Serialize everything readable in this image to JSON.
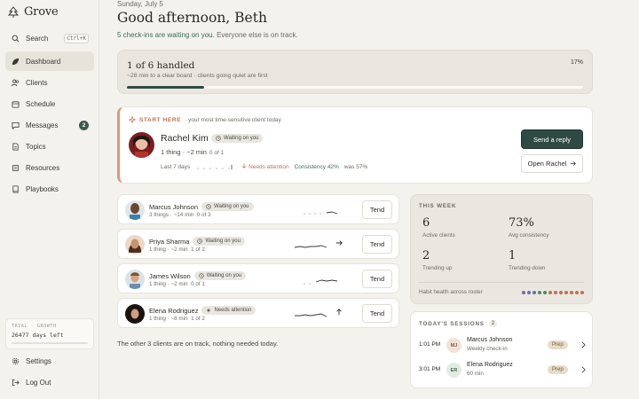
{
  "brand": {
    "name": "Grove"
  },
  "sidebar": {
    "items": [
      {
        "label": "Search",
        "shortcut": "Ctrl+K"
      },
      {
        "label": "Dashboard"
      },
      {
        "label": "Clients"
      },
      {
        "label": "Schedule"
      },
      {
        "label": "Messages",
        "badge": "2"
      },
      {
        "label": "Topics"
      },
      {
        "label": "Resources"
      },
      {
        "label": "Playbooks"
      }
    ],
    "trial": {
      "heading": "TRIAL · GROWTH",
      "days_left": "26477 days left"
    },
    "settings_label": "Settings",
    "logout_label": "Log Out"
  },
  "header": {
    "date": "Sunday, July 5",
    "greeting": "Good afternoon, Beth",
    "subline_link": "5 check-ins are waiting on you.",
    "subline_rest": "Everyone else is on track."
  },
  "progress": {
    "title": "1 of 6 handled",
    "subtitle": "~28 min to a clear board · clients going quiet are first",
    "percent_label": "17%",
    "fraction": 0.17
  },
  "start_here": {
    "label": "START HERE",
    "hint": "· your most time-sensitive client today",
    "client_name": "Rachel Kim",
    "status": "Waiting on you",
    "meta": "1 thing · ~2 min",
    "fraction": "0 of 1",
    "days_label": "Last 7 days",
    "attention": "Needs attention",
    "consistency": "Consistency 42%",
    "previous": "was 57%",
    "primary_button": "Send a reply",
    "secondary_button": "Open Rachel"
  },
  "clients": [
    {
      "name": "Marcus Johnson",
      "status": "Waiting on you",
      "meta": "3 things · ~14 min",
      "fraction": "0 of 3",
      "action": "Tend"
    },
    {
      "name": "Priya Sharma",
      "status": "Waiting on you",
      "meta": "1 thing · ~2 min",
      "fraction": "1 of 2",
      "action": "Tend"
    },
    {
      "name": "James Wilson",
      "status": "Waiting on you",
      "meta": "1 thing · ~2 min",
      "fraction": "0 of 1",
      "action": "Tend"
    },
    {
      "name": "Elena Rodriguez",
      "status": "Needs attention",
      "meta": "1 thing · ~8 min",
      "fraction": "1 of 2",
      "action": "Tend"
    }
  ],
  "on_track": "The other 3 clients are on track, nothing needed today.",
  "this_week": {
    "label": "THIS WEEK",
    "active": {
      "value": "6",
      "label": "Active clients"
    },
    "consistency": {
      "value": "73%",
      "label": "Avg consistency"
    },
    "up": {
      "value": "2",
      "label": "Trending up"
    },
    "down": {
      "value": "1",
      "label": "Trending down"
    },
    "roster_label": "Habit health across roster",
    "roster_dots": [
      "#6b6fa8",
      "#6b6fa8",
      "#6b6fa8",
      "#4a8a5e",
      "#4a8a5e",
      "#c0704f",
      "#c0704f",
      "#c0704f",
      "#c0704f",
      "#c0704f",
      "#c0704f",
      "#c0704f"
    ]
  },
  "sessions": {
    "label": "TODAY'S SESSIONS",
    "count": "2",
    "items": [
      {
        "time": "1:01 PM",
        "initials": "MJ",
        "name": "Marcus Johnson",
        "sub": "Weekly check-in",
        "tag": "Prep"
      },
      {
        "time": "3:01 PM",
        "initials": "ER",
        "name": "Elena Rodriguez",
        "sub": "60 min",
        "tag": "Prep"
      }
    ]
  },
  "colors": {
    "accent": "#2f4a42",
    "attention": "#c0704f",
    "link": "#3b6e5c"
  }
}
